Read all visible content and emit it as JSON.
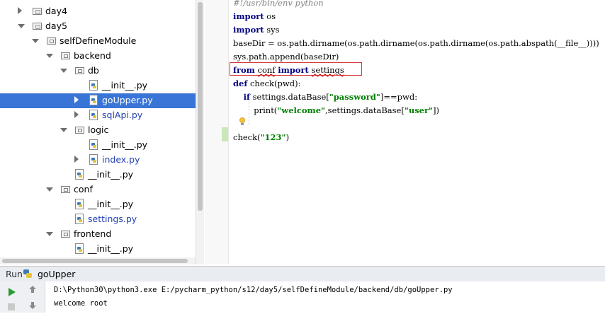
{
  "tree": {
    "items": [
      {
        "label": "day4",
        "type": "folder",
        "arrow": "right",
        "depth": 0,
        "selected": false,
        "blue": false
      },
      {
        "label": "day5",
        "type": "folder",
        "arrow": "down",
        "depth": 0,
        "selected": false,
        "blue": false
      },
      {
        "label": "selfDefineModule",
        "type": "pkg",
        "arrow": "down",
        "depth": 1,
        "selected": false,
        "blue": false
      },
      {
        "label": "backend",
        "type": "pkg",
        "arrow": "down",
        "depth": 2,
        "selected": false,
        "blue": false
      },
      {
        "label": "db",
        "type": "pkg",
        "arrow": "down",
        "depth": 3,
        "selected": false,
        "blue": false
      },
      {
        "label": "__init__.py",
        "type": "py",
        "arrow": "none",
        "depth": 4,
        "selected": false,
        "blue": false
      },
      {
        "label": "goUpper.py",
        "type": "py",
        "arrow": "right",
        "depth": 4,
        "selected": true,
        "blue": false
      },
      {
        "label": "sqlApi.py",
        "type": "py",
        "arrow": "right",
        "depth": 4,
        "selected": false,
        "blue": true
      },
      {
        "label": "logic",
        "type": "pkg",
        "arrow": "down",
        "depth": 3,
        "selected": false,
        "blue": false
      },
      {
        "label": "__init__.py",
        "type": "py",
        "arrow": "none",
        "depth": 4,
        "selected": false,
        "blue": false
      },
      {
        "label": "index.py",
        "type": "py",
        "arrow": "right",
        "depth": 4,
        "selected": false,
        "blue": true
      },
      {
        "label": "__init__.py",
        "type": "py",
        "arrow": "none",
        "depth": 3,
        "selected": false,
        "blue": false
      },
      {
        "label": "conf",
        "type": "pkg",
        "arrow": "down",
        "depth": 2,
        "selected": false,
        "blue": false
      },
      {
        "label": "__init__.py",
        "type": "py",
        "arrow": "none",
        "depth": 3,
        "selected": false,
        "blue": false
      },
      {
        "label": "settings.py",
        "type": "py",
        "arrow": "none",
        "depth": 3,
        "selected": false,
        "blue": true
      },
      {
        "label": "frontend",
        "type": "pkg",
        "arrow": "down",
        "depth": 2,
        "selected": false,
        "blue": false
      },
      {
        "label": "__init__.py",
        "type": "py",
        "arrow": "none",
        "depth": 3,
        "selected": false,
        "blue": false
      }
    ]
  },
  "editor": {
    "lines": [
      [
        {
          "t": "#!/usr/bin/env python",
          "c": "cm"
        }
      ],
      [
        {
          "t": "import",
          "c": "kw"
        },
        {
          "t": " os",
          "c": ""
        }
      ],
      [
        {
          "t": "import",
          "c": "kw"
        },
        {
          "t": " sys",
          "c": ""
        }
      ],
      [
        {
          "t": "baseDir = os.path.dirname(os.path.dirname(os.path.dirname(os.path.abspath(__file__))))",
          "c": ""
        }
      ],
      [
        {
          "t": "sys.path.append(baseDir)",
          "c": ""
        }
      ],
      [
        {
          "t": "from",
          "c": "kw"
        },
        {
          "t": " ",
          "c": ""
        },
        {
          "t": "conf",
          "c": "squig"
        },
        {
          "t": " ",
          "c": ""
        },
        {
          "t": "import",
          "c": "kw"
        },
        {
          "t": " ",
          "c": ""
        },
        {
          "t": "settings",
          "c": "squig"
        }
      ],
      [
        {
          "t": "def",
          "c": "kw"
        },
        {
          "t": " check(pwd):",
          "c": ""
        }
      ],
      [
        {
          "t": "    ",
          "c": ""
        },
        {
          "t": "if",
          "c": "kw"
        },
        {
          "t": " settings.dataBase[",
          "c": ""
        },
        {
          "t": "\"password\"",
          "c": "str"
        },
        {
          "t": "]==pwd:",
          "c": ""
        }
      ],
      [
        {
          "t": "        print(",
          "c": ""
        },
        {
          "t": "\"welcome\"",
          "c": "str"
        },
        {
          "t": ",settings.dataBase[",
          "c": ""
        },
        {
          "t": "\"user\"",
          "c": "str"
        },
        {
          "t": "])",
          "c": ""
        }
      ],
      [
        {
          "t": "",
          "c": ""
        }
      ],
      [
        {
          "t": "check(",
          "c": ""
        },
        {
          "t": "\"123\"",
          "c": "str"
        },
        {
          "t": ")",
          "c": ""
        }
      ]
    ]
  },
  "run": {
    "tab_label": "Run",
    "config_name": "goUpper",
    "output": [
      "D:\\Python30\\python3.exe E:/pycharm_python/s12/day5/selfDefineModule/backend/db/goUpper.py",
      "welcome root"
    ]
  },
  "colors": {
    "selection": "#3875d7",
    "keyword": "#000080",
    "string": "#008000",
    "highlight_border": "#d43838"
  }
}
